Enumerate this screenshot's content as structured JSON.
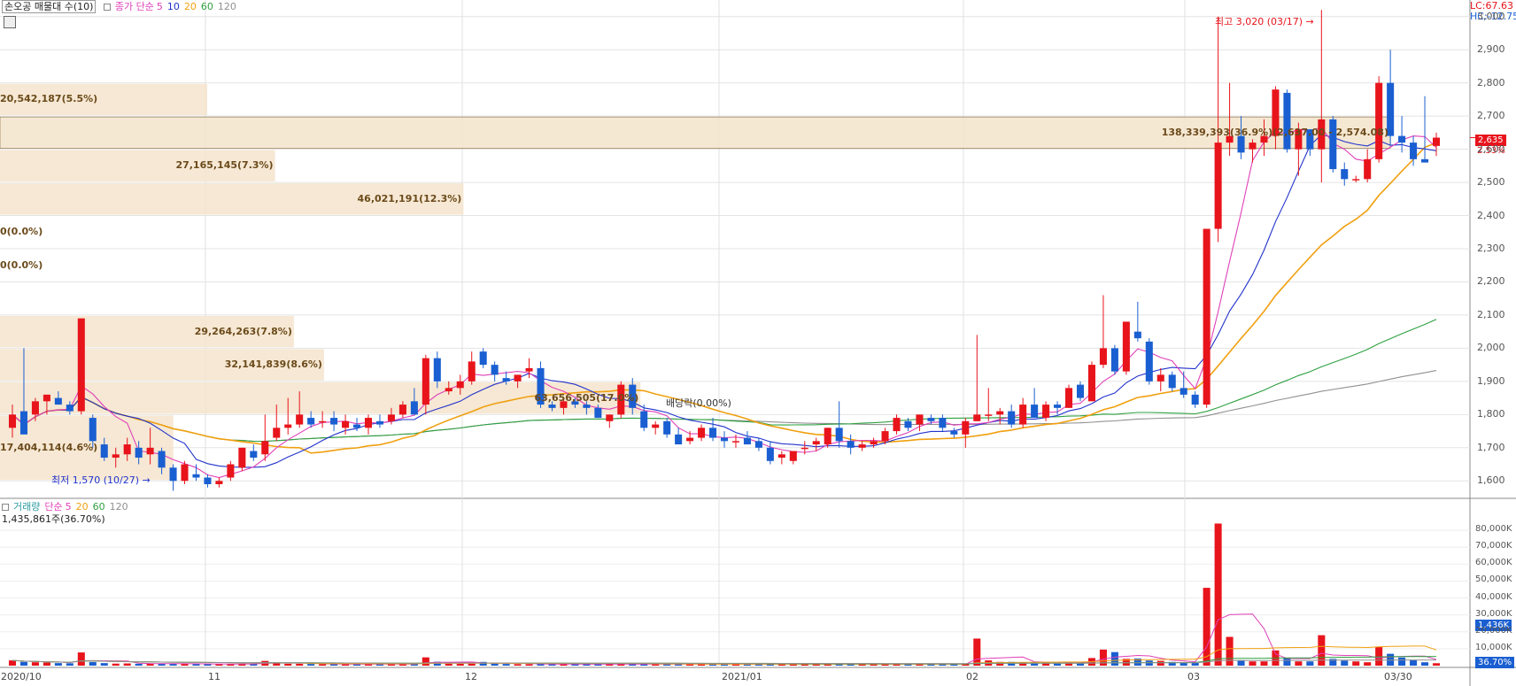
{
  "legend_price": {
    "title": "손오공 매물대 수(10)",
    "ma_label": "종가 단순",
    "periods": [
      "5",
      "10",
      "20",
      "60",
      "120"
    ]
  },
  "legend_volume": {
    "title": "거래량",
    "ma_label": "단순",
    "periods": [
      "5",
      "20",
      "60",
      "120"
    ],
    "current": "1,435,861주(36.70%)"
  },
  "right_indicators": {
    "lc": "LC:67.63",
    "hc": "HC:-12.75"
  },
  "price_axis": {
    "ticks": [
      1600,
      1700,
      1800,
      1900,
      2000,
      2100,
      2200,
      2300,
      2400,
      2500,
      2600,
      2700,
      2800,
      2900,
      3000
    ],
    "labels": [
      "1,600",
      "1,700",
      "1,800",
      "1,900",
      "2,000",
      "2,100",
      "2,200",
      "2,300",
      "2,400",
      "2,500",
      "2,600",
      "2,700",
      "2,800",
      "2,900",
      "3,000"
    ]
  },
  "volume_axis": {
    "labels": [
      "10,000K",
      "20,000K",
      "30,000K",
      "40,000K",
      "50,000K",
      "60,000K",
      "70,000K",
      "80,000K"
    ]
  },
  "x_labels": [
    "2020/10",
    "11",
    "12",
    "2021/01",
    "02",
    "03",
    "03/30"
  ],
  "current_price": {
    "value": "2,635",
    "pct": "2.53%",
    "volume": "1,436K",
    "vol_pct": "36.70%"
  },
  "annotations": {
    "high": "최고 3,020 (03/17)",
    "low": "최저 1,570 (10/27)",
    "dividend": "배당락(0.00%)"
  },
  "colors": {
    "up": "#e8141b",
    "down": "#1a5fd1",
    "ma5": "#e040b8",
    "ma10": "#2233cc",
    "ma20": "#f0a010",
    "ma60": "#2ea040",
    "ma120": "#909090",
    "vp": "#f4e4cc",
    "vp_current": "#f4e4cc"
  },
  "volume_profile": [
    {
      "price_low": 2700,
      "price_high": 2800,
      "volume": "20,542,187",
      "pct": "5.5%",
      "label": "20,542,187(5.5%)"
    },
    {
      "price_low": 2600,
      "price_high": 2700,
      "volume": "138,339,393",
      "pct": "36.9%",
      "label": "138,339,393(36.9%)(2,637.00 - 2,574.08)"
    },
    {
      "price_low": 2500,
      "price_high": 2600,
      "volume": "27,165,145",
      "pct": "7.3%",
      "label": "27,165,145(7.3%)"
    },
    {
      "price_low": 2400,
      "price_high": 2500,
      "volume": "46,021,191",
      "pct": "12.3%",
      "label": "46,021,191(12.3%)"
    },
    {
      "price_low": 2300,
      "price_high": 2400,
      "volume": "0",
      "pct": "0.0%",
      "label": "0(0.0%)"
    },
    {
      "price_low": 2200,
      "price_high": 2300,
      "volume": "0",
      "pct": "0.0%",
      "label": "0(0.0%)"
    },
    {
      "price_low": 2000,
      "price_high": 2100,
      "volume": "29,264,263",
      "pct": "7.8%",
      "label": "29,264,263(7.8%)"
    },
    {
      "price_low": 1900,
      "price_high": 2000,
      "volume": "32,141,839",
      "pct": "8.6%",
      "label": "32,141,839(8.6%)"
    },
    {
      "price_low": 1800,
      "price_high": 1900,
      "volume": "63,656,505",
      "pct": "17.0%",
      "label": "63,656,505(17.0%)"
    },
    {
      "price_low": 1600,
      "price_high": 1800,
      "volume": "17,404,114",
      "pct": "4.6%",
      "label": "17,404,114(4.6%)"
    }
  ],
  "chart_data": {
    "type": "candlestick",
    "price_range": [
      1550,
      3050
    ],
    "volume_range_k": [
      0,
      90000
    ],
    "candles": [
      {
        "o": 1760,
        "h": 1830,
        "l": 1730,
        "c": 1800
      },
      {
        "o": 1810,
        "h": 2000,
        "l": 1780,
        "c": 1740
      },
      {
        "o": 1800,
        "h": 1850,
        "l": 1780,
        "c": 1840
      },
      {
        "o": 1840,
        "h": 1860,
        "l": 1800,
        "c": 1860
      },
      {
        "o": 1850,
        "h": 1870,
        "l": 1830,
        "c": 1830
      },
      {
        "o": 1830,
        "h": 1840,
        "l": 1800,
        "c": 1810
      },
      {
        "o": 1810,
        "h": 2090,
        "l": 1800,
        "c": 2090
      },
      {
        "o": 1790,
        "h": 1800,
        "l": 1700,
        "c": 1720
      },
      {
        "o": 1710,
        "h": 1730,
        "l": 1660,
        "c": 1670
      },
      {
        "o": 1670,
        "h": 1700,
        "l": 1640,
        "c": 1680
      },
      {
        "o": 1680,
        "h": 1730,
        "l": 1660,
        "c": 1710
      },
      {
        "o": 1700,
        "h": 1720,
        "l": 1650,
        "c": 1670
      },
      {
        "o": 1680,
        "h": 1760,
        "l": 1650,
        "c": 1700
      },
      {
        "o": 1690,
        "h": 1700,
        "l": 1620,
        "c": 1640
      },
      {
        "o": 1640,
        "h": 1650,
        "l": 1570,
        "c": 1600
      },
      {
        "o": 1600,
        "h": 1660,
        "l": 1590,
        "c": 1650
      },
      {
        "o": 1620,
        "h": 1650,
        "l": 1600,
        "c": 1610
      },
      {
        "o": 1610,
        "h": 1620,
        "l": 1580,
        "c": 1590
      },
      {
        "o": 1590,
        "h": 1610,
        "l": 1580,
        "c": 1600
      },
      {
        "o": 1610,
        "h": 1660,
        "l": 1600,
        "c": 1650
      },
      {
        "o": 1640,
        "h": 1700,
        "l": 1630,
        "c": 1700
      },
      {
        "o": 1690,
        "h": 1710,
        "l": 1660,
        "c": 1670
      },
      {
        "o": 1680,
        "h": 1800,
        "l": 1660,
        "c": 1720
      },
      {
        "o": 1730,
        "h": 1830,
        "l": 1720,
        "c": 1760
      },
      {
        "o": 1760,
        "h": 1850,
        "l": 1740,
        "c": 1770
      },
      {
        "o": 1770,
        "h": 1870,
        "l": 1760,
        "c": 1800
      },
      {
        "o": 1790,
        "h": 1810,
        "l": 1760,
        "c": 1770
      },
      {
        "o": 1780,
        "h": 1810,
        "l": 1760,
        "c": 1780
      },
      {
        "o": 1790,
        "h": 1810,
        "l": 1750,
        "c": 1770
      },
      {
        "o": 1760,
        "h": 1800,
        "l": 1740,
        "c": 1780
      },
      {
        "o": 1770,
        "h": 1790,
        "l": 1750,
        "c": 1760
      },
      {
        "o": 1760,
        "h": 1800,
        "l": 1740,
        "c": 1790
      },
      {
        "o": 1780,
        "h": 1800,
        "l": 1760,
        "c": 1770
      },
      {
        "o": 1780,
        "h": 1820,
        "l": 1770,
        "c": 1800
      },
      {
        "o": 1800,
        "h": 1840,
        "l": 1790,
        "c": 1830
      },
      {
        "o": 1840,
        "h": 1880,
        "l": 1800,
        "c": 1800
      },
      {
        "o": 1830,
        "h": 1980,
        "l": 1800,
        "c": 1970
      },
      {
        "o": 1970,
        "h": 1990,
        "l": 1880,
        "c": 1900
      },
      {
        "o": 1870,
        "h": 1900,
        "l": 1860,
        "c": 1880
      },
      {
        "o": 1880,
        "h": 1920,
        "l": 1860,
        "c": 1900
      },
      {
        "o": 1900,
        "h": 1990,
        "l": 1890,
        "c": 1960
      },
      {
        "o": 1990,
        "h": 2000,
        "l": 1940,
        "c": 1950
      },
      {
        "o": 1950,
        "h": 1960,
        "l": 1900,
        "c": 1920
      },
      {
        "o": 1910,
        "h": 1930,
        "l": 1890,
        "c": 1900
      },
      {
        "o": 1900,
        "h": 1920,
        "l": 1880,
        "c": 1920
      },
      {
        "o": 1930,
        "h": 1970,
        "l": 1910,
        "c": 1940
      },
      {
        "o": 1940,
        "h": 1960,
        "l": 1820,
        "c": 1830
      },
      {
        "o": 1830,
        "h": 1840,
        "l": 1810,
        "c": 1820
      },
      {
        "o": 1820,
        "h": 1850,
        "l": 1800,
        "c": 1840
      },
      {
        "o": 1840,
        "h": 1850,
        "l": 1820,
        "c": 1830
      },
      {
        "o": 1830,
        "h": 1840,
        "l": 1800,
        "c": 1820
      },
      {
        "o": 1820,
        "h": 1830,
        "l": 1790,
        "c": 1790
      },
      {
        "o": 1780,
        "h": 1800,
        "l": 1760,
        "c": 1800
      },
      {
        "o": 1800,
        "h": 1900,
        "l": 1790,
        "c": 1890
      },
      {
        "o": 1890,
        "h": 1910,
        "l": 1800,
        "c": 1820
      },
      {
        "o": 1810,
        "h": 1830,
        "l": 1750,
        "c": 1760
      },
      {
        "o": 1760,
        "h": 1780,
        "l": 1740,
        "c": 1770
      },
      {
        "o": 1780,
        "h": 1790,
        "l": 1730,
        "c": 1740
      },
      {
        "o": 1740,
        "h": 1760,
        "l": 1710,
        "c": 1710
      },
      {
        "o": 1720,
        "h": 1750,
        "l": 1710,
        "c": 1730
      },
      {
        "o": 1730,
        "h": 1770,
        "l": 1720,
        "c": 1760
      },
      {
        "o": 1760,
        "h": 1790,
        "l": 1720,
        "c": 1730
      },
      {
        "o": 1730,
        "h": 1750,
        "l": 1700,
        "c": 1720
      },
      {
        "o": 1720,
        "h": 1740,
        "l": 1700,
        "c": 1720
      },
      {
        "o": 1730,
        "h": 1750,
        "l": 1710,
        "c": 1710
      },
      {
        "o": 1720,
        "h": 1730,
        "l": 1690,
        "c": 1700
      },
      {
        "o": 1700,
        "h": 1720,
        "l": 1650,
        "c": 1660
      },
      {
        "o": 1670,
        "h": 1690,
        "l": 1650,
        "c": 1680
      },
      {
        "o": 1660,
        "h": 1690,
        "l": 1650,
        "c": 1690
      },
      {
        "o": 1700,
        "h": 1720,
        "l": 1680,
        "c": 1700
      },
      {
        "o": 1710,
        "h": 1730,
        "l": 1690,
        "c": 1720
      },
      {
        "o": 1710,
        "h": 1760,
        "l": 1700,
        "c": 1760
      },
      {
        "o": 1760,
        "h": 1840,
        "l": 1700,
        "c": 1720
      },
      {
        "o": 1720,
        "h": 1740,
        "l": 1680,
        "c": 1700
      },
      {
        "o": 1700,
        "h": 1720,
        "l": 1690,
        "c": 1710
      },
      {
        "o": 1710,
        "h": 1730,
        "l": 1700,
        "c": 1720
      },
      {
        "o": 1720,
        "h": 1760,
        "l": 1710,
        "c": 1750
      },
      {
        "o": 1750,
        "h": 1800,
        "l": 1740,
        "c": 1790
      },
      {
        "o": 1780,
        "h": 1790,
        "l": 1750,
        "c": 1760
      },
      {
        "o": 1770,
        "h": 1800,
        "l": 1750,
        "c": 1800
      },
      {
        "o": 1790,
        "h": 1800,
        "l": 1770,
        "c": 1780
      },
      {
        "o": 1790,
        "h": 1800,
        "l": 1750,
        "c": 1760
      },
      {
        "o": 1750,
        "h": 1760,
        "l": 1730,
        "c": 1740
      },
      {
        "o": 1740,
        "h": 1790,
        "l": 1700,
        "c": 1780
      },
      {
        "o": 1780,
        "h": 2040,
        "l": 1780,
        "c": 1800
      },
      {
        "o": 1800,
        "h": 1880,
        "l": 1780,
        "c": 1800
      },
      {
        "o": 1800,
        "h": 1820,
        "l": 1770,
        "c": 1810
      },
      {
        "o": 1810,
        "h": 1830,
        "l": 1760,
        "c": 1770
      },
      {
        "o": 1770,
        "h": 1850,
        "l": 1760,
        "c": 1830
      },
      {
        "o": 1830,
        "h": 1880,
        "l": 1800,
        "c": 1790
      },
      {
        "o": 1790,
        "h": 1840,
        "l": 1780,
        "c": 1830
      },
      {
        "o": 1830,
        "h": 1840,
        "l": 1800,
        "c": 1820
      },
      {
        "o": 1820,
        "h": 1890,
        "l": 1820,
        "c": 1880
      },
      {
        "o": 1890,
        "h": 1900,
        "l": 1840,
        "c": 1850
      },
      {
        "o": 1840,
        "h": 1960,
        "l": 1840,
        "c": 1950
      },
      {
        "o": 1950,
        "h": 2160,
        "l": 1940,
        "c": 2000
      },
      {
        "o": 2000,
        "h": 2010,
        "l": 1920,
        "c": 1930
      },
      {
        "o": 1930,
        "h": 2080,
        "l": 1920,
        "c": 2080
      },
      {
        "o": 2050,
        "h": 2140,
        "l": 2020,
        "c": 2030
      },
      {
        "o": 2020,
        "h": 2030,
        "l": 1890,
        "c": 1900
      },
      {
        "o": 1900,
        "h": 1940,
        "l": 1870,
        "c": 1920
      },
      {
        "o": 1920,
        "h": 1930,
        "l": 1870,
        "c": 1880
      },
      {
        "o": 1880,
        "h": 1930,
        "l": 1850,
        "c": 1860
      },
      {
        "o": 1860,
        "h": 1870,
        "l": 1820,
        "c": 1830
      },
      {
        "o": 1830,
        "h": 2360,
        "l": 1820,
        "c": 2360
      },
      {
        "o": 2360,
        "h": 3000,
        "l": 2320,
        "c": 2620
      },
      {
        "o": 2620,
        "h": 2800,
        "l": 2580,
        "c": 2640
      },
      {
        "o": 2640,
        "h": 2700,
        "l": 2570,
        "c": 2590
      },
      {
        "o": 2600,
        "h": 2630,
        "l": 2560,
        "c": 2620
      },
      {
        "o": 2620,
        "h": 2690,
        "l": 2580,
        "c": 2640
      },
      {
        "o": 2640,
        "h": 2790,
        "l": 2600,
        "c": 2780
      },
      {
        "o": 2770,
        "h": 2780,
        "l": 2590,
        "c": 2600
      },
      {
        "o": 2600,
        "h": 2680,
        "l": 2520,
        "c": 2660
      },
      {
        "o": 2660,
        "h": 2660,
        "l": 2580,
        "c": 2600
      },
      {
        "o": 2600,
        "h": 3020,
        "l": 2500,
        "c": 2690
      },
      {
        "o": 2690,
        "h": 2700,
        "l": 2530,
        "c": 2540
      },
      {
        "o": 2540,
        "h": 2560,
        "l": 2490,
        "c": 2510
      },
      {
        "o": 2510,
        "h": 2520,
        "l": 2500,
        "c": 2510
      },
      {
        "o": 2510,
        "h": 2600,
        "l": 2500,
        "c": 2570
      },
      {
        "o": 2570,
        "h": 2820,
        "l": 2560,
        "c": 2800
      },
      {
        "o": 2800,
        "h": 2900,
        "l": 2610,
        "c": 2640
      },
      {
        "o": 2640,
        "h": 2700,
        "l": 2590,
        "c": 2620
      },
      {
        "o": 2620,
        "h": 2640,
        "l": 2550,
        "c": 2570
      },
      {
        "o": 2570,
        "h": 2760,
        "l": 2560,
        "c": 2560
      },
      {
        "o": 2610,
        "h": 2650,
        "l": 2580,
        "c": 2635
      }
    ],
    "volume_k": [
      3100,
      2200,
      2000,
      1800,
      1500,
      1400,
      7800,
      2100,
      1500,
      1200,
      1300,
      1100,
      1300,
      1200,
      1100,
      1000,
      1000,
      900,
      900,
      1000,
      1100,
      1100,
      2800,
      1500,
      1100,
      1100,
      1000,
      900,
      900,
      900,
      900,
      900,
      900,
      900,
      900,
      1000,
      4900,
      2300,
      1200,
      1100,
      1200,
      2200,
      1400,
      1000,
      900,
      900,
      1000,
      900,
      900,
      900,
      900,
      900,
      900,
      900,
      900,
      900,
      900,
      900,
      900,
      900,
      900,
      900,
      900,
      900,
      900,
      900,
      900,
      900,
      900,
      900,
      900,
      900,
      900,
      900,
      900,
      900,
      900,
      900,
      900,
      900,
      900,
      900,
      900,
      900,
      16000,
      3100,
      2200,
      2200,
      2000,
      2000,
      1800,
      1600,
      1600,
      1600,
      4500,
      9500,
      8000,
      4000,
      4200,
      3000,
      2800,
      2200,
      1800,
      1800,
      46000,
      84000,
      17000,
      3000,
      2500,
      2500,
      9000,
      4500,
      2500,
      2500,
      18000,
      4000,
      3000,
      2500,
      2000,
      11000,
      7000,
      4800,
      3200,
      2000,
      1436
    ]
  }
}
